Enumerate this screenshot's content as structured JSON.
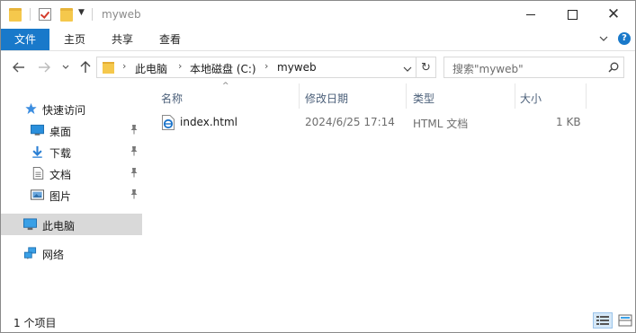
{
  "window": {
    "title": "myweb"
  },
  "ribbon": {
    "tabs": [
      {
        "label": "文件"
      },
      {
        "label": "主页"
      },
      {
        "label": "共享"
      },
      {
        "label": "查看"
      }
    ],
    "help_label": "?"
  },
  "address": {
    "crumbs": [
      "此电脑",
      "本地磁盘 (C:)",
      "myweb"
    ]
  },
  "search": {
    "placeholder": "搜索\"myweb\""
  },
  "navpane": {
    "quick_access": "快速访问",
    "items": [
      {
        "label": "桌面",
        "pinned": true,
        "icon": "desktop-icon"
      },
      {
        "label": "下载",
        "pinned": true,
        "icon": "download-icon"
      },
      {
        "label": "文档",
        "pinned": true,
        "icon": "document-icon"
      },
      {
        "label": "图片",
        "pinned": true,
        "icon": "pictures-icon"
      }
    ],
    "this_pc": "此电脑",
    "network": "网络"
  },
  "columns": [
    "名称",
    "修改日期",
    "类型",
    "大小"
  ],
  "files": [
    {
      "name": "index.html",
      "modified": "2024/6/25 17:14",
      "type": "HTML 文档",
      "size": "1 KB",
      "icon": "edge-html-icon"
    }
  ],
  "status": {
    "count_text": "1 个项目"
  },
  "colors": {
    "accent": "#1979ca",
    "selected_nav": "#d9d9d9",
    "header_text": "#4c607a"
  }
}
